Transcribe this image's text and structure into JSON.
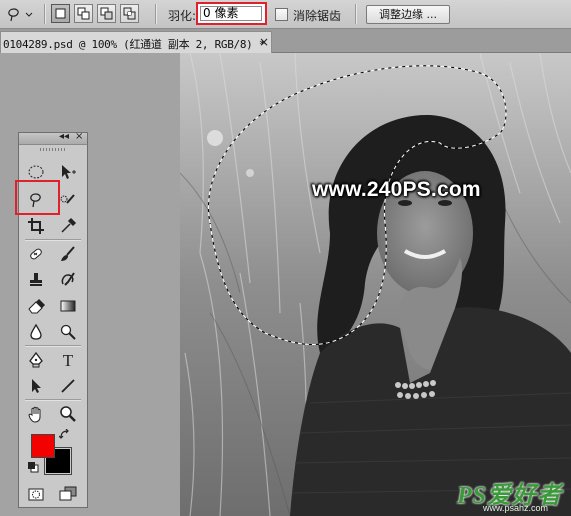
{
  "options_bar": {
    "feather_label": "羽化:",
    "feather_value": "0 像素",
    "antialias_label": "消除锯齿",
    "antialias_checked": false,
    "refine_edge_label": "调整边缘 ..."
  },
  "document": {
    "tab_title": "0104289.psd @ 100% (红通道 副本 2, RGB/8) *",
    "close_glyph": "×"
  },
  "toolbox": {
    "collapse_glyph": "◂◂",
    "close_glyph": "×",
    "active_tool": "lasso-tool",
    "foreground_color": "#f30000",
    "background_color": "#000000",
    "text_tool_glyph": "T"
  },
  "canvas": {
    "watermark": "www.240PS.com",
    "logo": "PS爱好者",
    "logo_url": "www.psahz.com"
  },
  "colors": {
    "highlight": "#e0202a"
  }
}
